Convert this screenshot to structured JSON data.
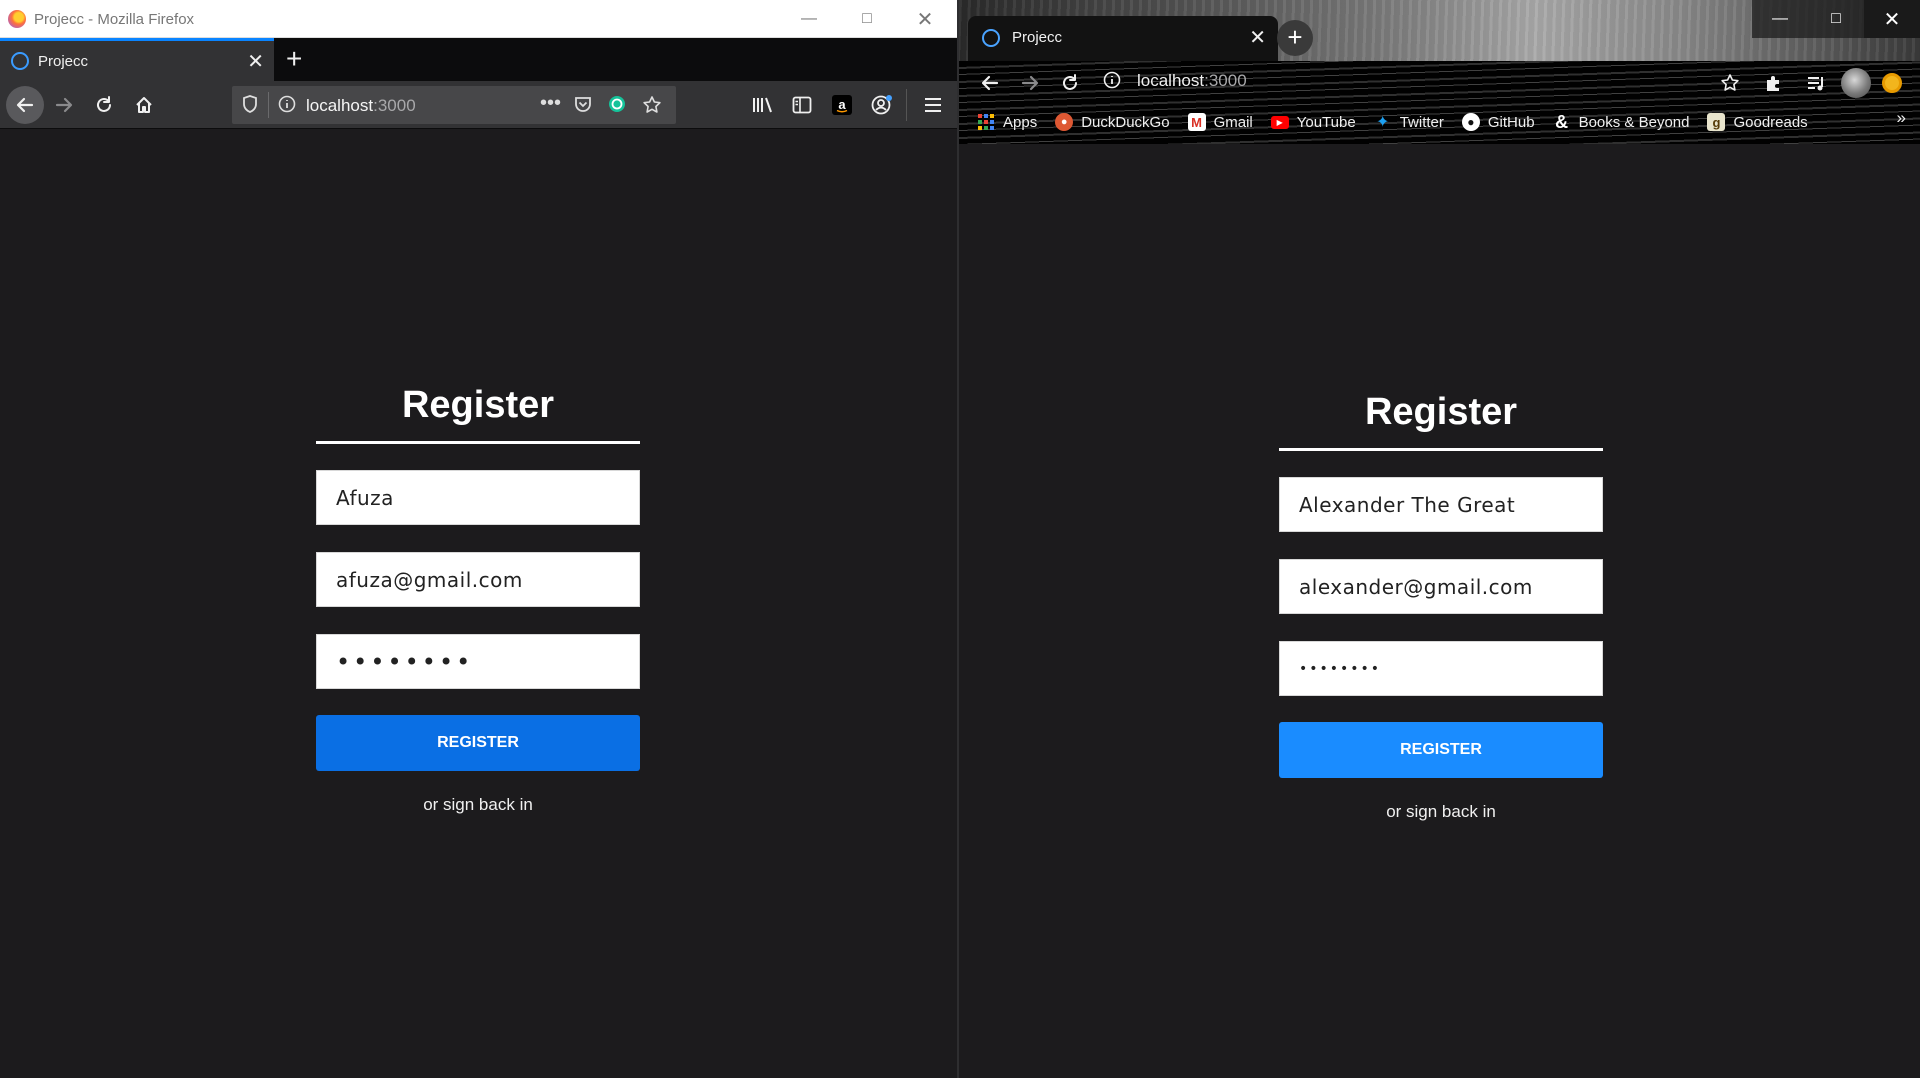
{
  "firefox": {
    "window_title": "Projecc - Mozilla Firefox",
    "tab_label": "Projecc",
    "url_host": "localhost",
    "url_port": ":3000"
  },
  "chrome": {
    "tab_label": "Projecc",
    "url_host": "localhost",
    "url_port": ":3000",
    "bookmarks": [
      "Apps",
      "DuckDuckGo",
      "Gmail",
      "YouTube",
      "Twitter",
      "GitHub",
      "Books & Beyond",
      "Goodreads"
    ],
    "more_label": "»"
  },
  "form_left": {
    "heading": "Register",
    "name_value": "Afuza",
    "email_value": "afuza@gmail.com",
    "password_value": "12345678",
    "button_label": "REGISTER",
    "signin_text": "or sign back in"
  },
  "form_right": {
    "heading": "Register",
    "name_value": "Alexander The Great",
    "email_value": "alexander@gmail.com",
    "password_value": "12345678",
    "button_label": "REGISTER",
    "signin_text": "or sign back in"
  },
  "colors": {
    "page_background": "#1c1b1d",
    "firefox_button": "#0a6fe4",
    "chrome_button": "#1a8cff",
    "firefox_accent": "#0a84ff"
  },
  "icons": {
    "back": "left-arrow-icon",
    "forward": "right-arrow-icon",
    "reload": "reload-icon",
    "home": "home-icon",
    "shield": "shield-icon",
    "info": "info-icon",
    "more": "ellipsis-icon",
    "pocket": "pocket-icon",
    "star": "star-icon",
    "library": "library-icon",
    "sidebar": "sidebar-icon",
    "amazon": "amazon-icon",
    "account": "account-icon",
    "menu": "hamburger-menu-icon",
    "extensions": "puzzle-icon",
    "media": "media-queue-icon",
    "avatar": "avatar"
  }
}
